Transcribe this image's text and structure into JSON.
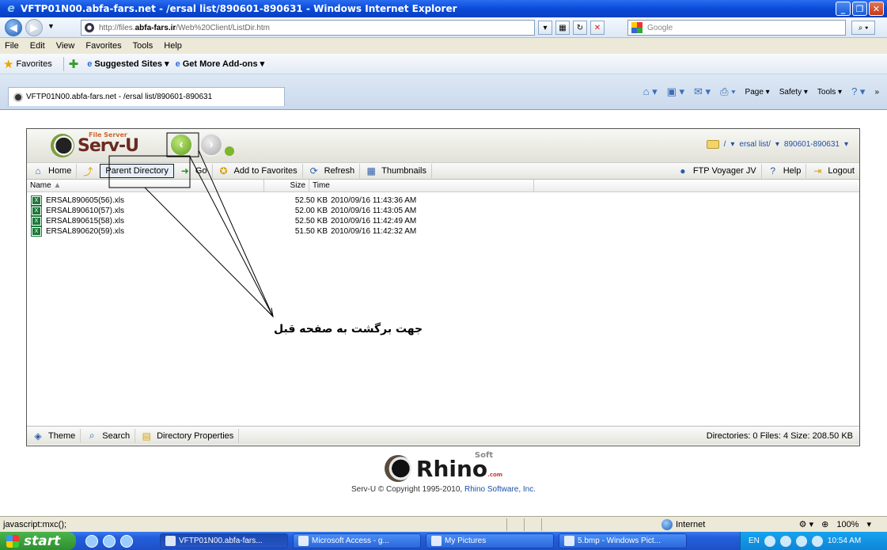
{
  "window": {
    "title": "VFTP01N00.abfa-fars.net - /ersal list/890601-890631 - Windows Internet Explorer"
  },
  "address": {
    "prefix": "http://files.",
    "domain": "abfa-fars.ir",
    "path": "/Web%20Client/ListDir.htm"
  },
  "search": {
    "placeholder": "Google"
  },
  "menu": [
    "File",
    "Edit",
    "View",
    "Favorites",
    "Tools",
    "Help"
  ],
  "favbar": {
    "favorites": "Favorites",
    "suggested": "Suggested Sites",
    "addons": "Get More Add-ons"
  },
  "tab": {
    "label": "VFTP01N00.abfa-fars.net - /ersal list/890601-890631"
  },
  "tabtools": {
    "page": "Page",
    "safety": "Safety",
    "tools": "Tools"
  },
  "app": {
    "logo_small": "File Server",
    "logo": "Serv-U",
    "crumb": [
      "/",
      "ersal list/",
      "890601-890631"
    ],
    "toolbar": {
      "home": "Home",
      "parent": "Parent Directory",
      "go": "Go",
      "add_fav": "Add to Favorites",
      "refresh": "Refresh",
      "thumbs": "Thumbnails",
      "ftp": "FTP Voyager JV",
      "help": "Help",
      "logout": "Logout"
    },
    "columns": {
      "name": "Name",
      "size": "Size",
      "time": "Time"
    },
    "files": [
      {
        "name": "ERSAL890605(56).xls",
        "size": "52.50 KB",
        "time": "2010/09/16 11:43:36 AM"
      },
      {
        "name": "ERSAL890610(57).xls",
        "size": "52.00 KB",
        "time": "2010/09/16 11:43:05 AM"
      },
      {
        "name": "ERSAL890615(58).xls",
        "size": "52.50 KB",
        "time": "2010/09/16 11:42:49 AM"
      },
      {
        "name": "ERSAL890620(59).xls",
        "size": "51.50 KB",
        "time": "2010/09/16 11:42:32 AM"
      }
    ],
    "bottom": {
      "theme": "Theme",
      "search": "Search",
      "dirprops": "Directory Properties",
      "summary": "Directories: 0   Files: 4   Size: 208.50 KB"
    }
  },
  "footer": {
    "brand": "Rhino",
    "soft": "Soft",
    "com": ".com",
    "copy_pre": "Serv-U © Copyright 1995-2010, ",
    "copy_link": "Rhino Software, Inc."
  },
  "annotation": {
    "text": "جهت برگشت به صفحه قبل"
  },
  "statusbar": {
    "left": "javascript:mxc();",
    "zone": "Internet",
    "zoom": "100%"
  },
  "taskbar": {
    "start": "start",
    "tasks": [
      "VFTP01N00.abfa-fars...",
      "Microsoft Access - g...",
      "My Pictures",
      "5.bmp - Windows Pict..."
    ],
    "lang": "EN",
    "clock": "10:54 AM"
  }
}
